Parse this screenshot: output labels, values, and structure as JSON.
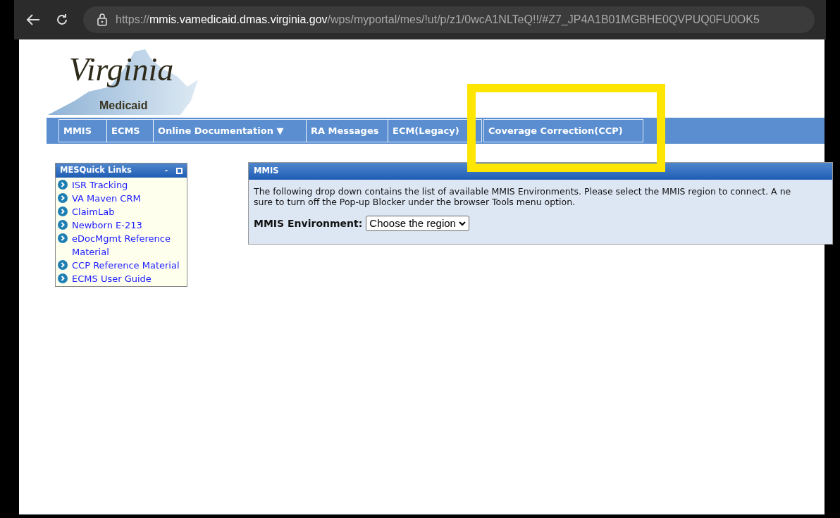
{
  "browser": {
    "url": "https://**mmis.vamedicaid.dmas.virginia.gov**/wps/myportal/mes/!ut/p/z1/0wcA1NLTeQ!!/#Z7_JP4A1B01MGBHE0QVPUQ0FU0OK5"
  },
  "logo": {
    "title": "Virginia",
    "subtitle": "Medicaid"
  },
  "nav": [
    {
      "label": "MMIS",
      "highlighted": false
    },
    {
      "label": "ECMS",
      "highlighted": false
    },
    {
      "label": "Online Documentation ▼",
      "highlighted": false
    },
    {
      "label": "RA Messages",
      "highlighted": false
    },
    {
      "label": "ECM(Legacy)",
      "highlighted": false
    },
    {
      "label": "Coverage Correction(CCP)",
      "highlighted": true
    }
  ],
  "quick_links": {
    "title": "MESQuick Links",
    "minimize": "-",
    "items": [
      "ISR Tracking",
      "VA Maven CRM",
      "ClaimLab",
      "Newborn E-213",
      "eDocMgmt Reference Material",
      "CCP Reference Material",
      "ECMS User Guide"
    ]
  },
  "mmis_panel": {
    "title": "MMIS",
    "lines": [
      "The following drop down contains the list of available MMIS Environments. Please select the MMIS region to connect. A ne",
      "sure to turn off the Pop-up Blocker under the browser Tools menu option."
    ],
    "field_label": "MMIS Environment:",
    "select_value": "Choose the region"
  }
}
